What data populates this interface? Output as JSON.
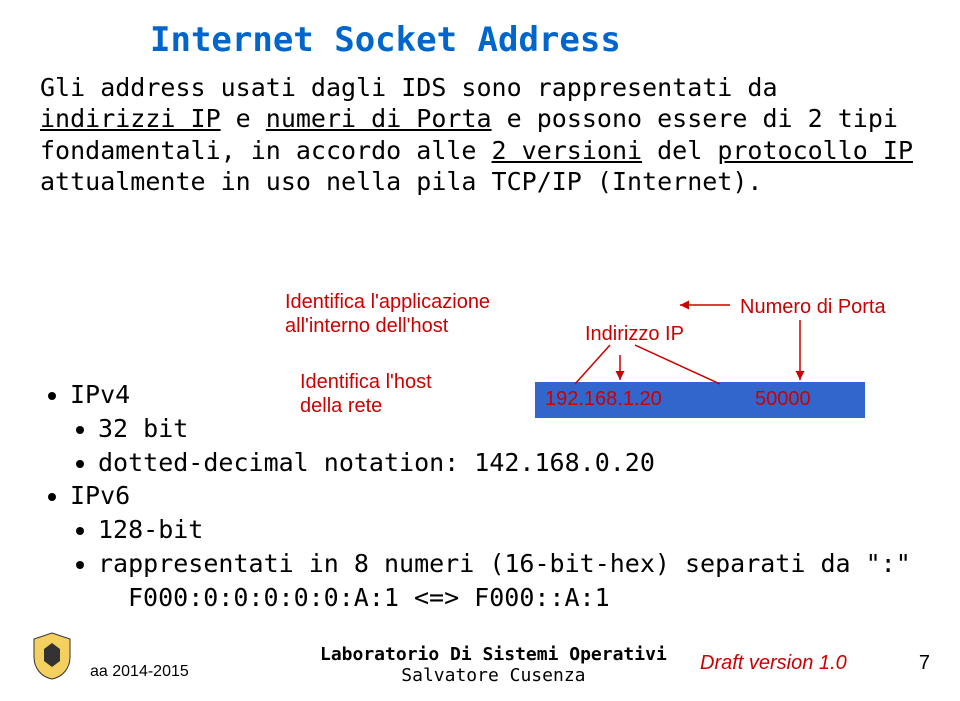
{
  "title": "Internet Socket Address",
  "paragraph": {
    "part1": "Gli address usati dagli IDS sono rappresentati da ",
    "under1": "indirizzi IP",
    "part2": " e ",
    "under2": "numeri di Porta",
    "part3": " e possono essere di 2 tipi fondamentali, in accordo alle ",
    "under3": "2 versioni",
    "part4": " del ",
    "under4": "protocollo IP",
    "part5": " attualmente in uso nella pila TCP/IP (Internet)."
  },
  "labels": {
    "app_line1": "Identifica l'applicazione",
    "app_line2": "all'interno dell'host",
    "ip": "Indirizzo IP",
    "porta": "Numero di Porta",
    "host_line1": "Identifica l'host",
    "host_line2": "della rete"
  },
  "box": {
    "ip": "192.168.1.20",
    "port": "50000"
  },
  "bullets": {
    "ipv4": "IPv4",
    "ipv4_bits": "32 bit",
    "ipv4_dotted": "dotted-decimal notation: 142.168.0.20",
    "ipv6": "IPv6",
    "ipv6_bits": "128-bit",
    "ipv6_repr": "rappresentati in 8 numeri (16-bit-hex) separati da \":\"",
    "ipv6_ex": "F000:0:0:0:0:0:A:1 <=> F000::A:1"
  },
  "footer": {
    "year": "aa 2014-2015",
    "center1": "Laboratorio Di Sistemi Operativi",
    "center2": "Salvatore Cusenza",
    "draft": "Draft version 1.0",
    "page": "7"
  }
}
